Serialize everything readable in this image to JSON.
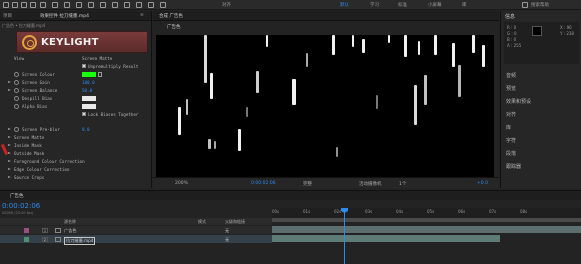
{
  "toolbar": {
    "workspaces": [
      "默认",
      "学习",
      "标准",
      "小屏幕",
      "库"
    ],
    "active_workspace": "默认",
    "search_placeholder": "搜索帮助",
    "snap_label": "对齐"
  },
  "effect_controls": {
    "tabs": [
      "项目",
      "效果控件 拉刀缝墨.mp4"
    ],
    "panel_menu": "≡",
    "path": "广告色 • 拉刀缝墨.mp4",
    "logo_text": "KEYLIGHT",
    "rows": [
      {
        "label": "View",
        "value": "Screen Matte",
        "kind": "plain"
      },
      {
        "label": "",
        "value": "Unpremultiply Result",
        "kind": "check"
      },
      {
        "label": "Screen Colour",
        "value": "",
        "kind": "color"
      },
      {
        "label": "Screen Gain",
        "value": "100.0",
        "kind": "num"
      },
      {
        "label": "Screen Balance",
        "value": "50.0",
        "kind": "num"
      },
      {
        "label": "Despill Bias",
        "value": "",
        "kind": "color2"
      },
      {
        "label": "Alpha Bias",
        "value": "",
        "kind": "color2"
      },
      {
        "label": "",
        "value": "Lock Biases Together",
        "kind": "check"
      },
      {
        "label": "Screen Pre-blur",
        "value": "0.0",
        "kind": "num"
      },
      {
        "label": "Screen Matte",
        "value": "",
        "kind": "group"
      },
      {
        "label": "Inside Mask",
        "value": "",
        "kind": "group"
      },
      {
        "label": "Outside Mask",
        "value": "",
        "kind": "group"
      },
      {
        "label": "Foreground Colour Correction",
        "value": "",
        "kind": "group"
      },
      {
        "label": "Edge Colour Correction",
        "value": "",
        "kind": "group"
      },
      {
        "label": "Source Crops",
        "value": "",
        "kind": "group"
      }
    ]
  },
  "composition": {
    "tab_label": "合成 广告色",
    "sub_tab": "广告色",
    "bottom": {
      "zoom": "200%",
      "time": "0:00:02:06",
      "resolution": "完整",
      "camera": "活动摄像机",
      "views": "1个",
      "exposure": "+0.0"
    }
  },
  "info_panel": {
    "title": "信息",
    "r": "R : 0",
    "g": "G : 0",
    "b": "B : 0",
    "a": "A : 255",
    "x": "X : 96",
    "y": "Y : 238",
    "items": [
      "音频",
      "预览",
      "效果和预设",
      "对齐",
      "库",
      "字符",
      "段落",
      "跟踪器"
    ]
  },
  "timeline": {
    "tab_label": "广告色",
    "timecode": "0:00:02:06",
    "sub": "00056 (25.00 fps)",
    "columns": {
      "source": "源名称",
      "mode": "模式",
      "parent": "父级和链接"
    },
    "ruler_labels": [
      "00s",
      "01s",
      "02s",
      "03s",
      "04s",
      "05s",
      "06s",
      "07s",
      "08s"
    ],
    "layers": [
      {
        "index": "1",
        "name": "广告色",
        "parent": "无",
        "color": "#9a4f7f",
        "bar_color": "#5c6f6e"
      },
      {
        "index": "2",
        "name": "拉刀缝墨.mp4",
        "parent": "无",
        "color": "#4f8f74",
        "bar_color": "#5f7b76"
      }
    ]
  },
  "colors": {
    "accent": "#2d8ceb",
    "screen_colour": "#19ff0b",
    "keylight_bg": "#6c3232"
  }
}
